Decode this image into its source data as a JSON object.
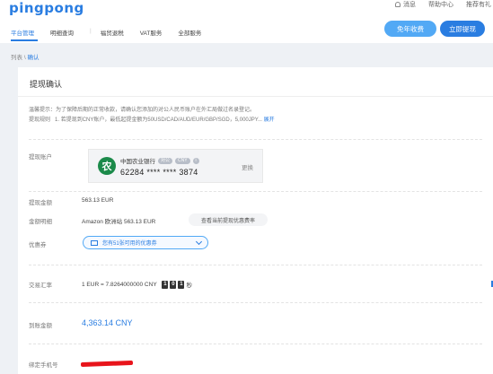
{
  "brand": {
    "logo": "pingpong"
  },
  "header_links": {
    "messages": "消息",
    "help": "帮助中心",
    "referral": "推荐有礼"
  },
  "nav": [
    "平台管理",
    "明细查询",
    "福贸退税",
    "VAT服务",
    "全部服务"
  ],
  "actions": {
    "annual_fee": "免年收费",
    "withdraw": "立即提现"
  },
  "breadcrumb": {
    "list": "列表",
    "sep": "\\",
    "current": "确认"
  },
  "page": {
    "title": "提现确认",
    "notice_prefix": "温馨提示：为了保障后期的正常收款，请确认您添加的对公人民币账户在外汇局做过名录登记。",
    "rules_label": "提现规则",
    "rules_text": "1. 若提现到CNY账户，最低起提金额为50USD/CAD/AUD/EUR/GBP/SGD，5,000JPY...",
    "rules_expand": "展开"
  },
  "account": {
    "label": "提现账户",
    "bank_name": "中国农业银行",
    "tag1": "对公",
    "tag2": "CNY",
    "tag3": "i",
    "number": "62284 **** **** 3874",
    "change": "更换",
    "logo_glyph": "农"
  },
  "amount": {
    "label": "提现金额",
    "value": "563.13 EUR"
  },
  "detail": {
    "label": "金额明细",
    "value": "Amazon 欧洲站   563.13  EUR",
    "rate_button": "查看当前提现优惠费率"
  },
  "coupon": {
    "label": "优惠券",
    "text": "您有51张可用的优惠券"
  },
  "exchange": {
    "label": "交易汇率",
    "value": "1 EUR = 7.8264000000 CNY",
    "d1": "1",
    "d2": "0",
    "d3": "1",
    "unit": "秒"
  },
  "arrival": {
    "label": "到账金额",
    "value": "4,363.14 CNY"
  },
  "phone": {
    "label": "绑定手机号"
  },
  "colors": {
    "accent": "#2a7de1",
    "accent_light": "#52a9f5",
    "bank_green": "#1b8a4a",
    "redact": "#e8141b"
  }
}
